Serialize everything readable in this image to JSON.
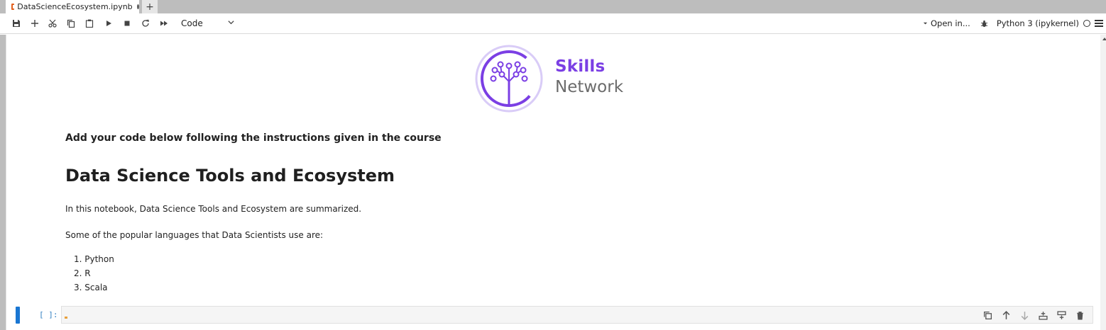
{
  "tab": {
    "title": "DataScienceEcosystem.ipynb",
    "new_tab": "+"
  },
  "toolbar": {
    "cell_type": "Code",
    "open_in": "Open in...",
    "kernel": "Python 3 (ipykernel)"
  },
  "logo": {
    "line1": "Skills",
    "line2": "Network",
    "brand_purple": "#7b3fe4"
  },
  "notebook": {
    "instruction": "Add your code below following the instructions given in the course",
    "heading": "Data Science Tools and Ecosystem",
    "intro": "In this notebook, Data Science Tools and Ecosystem are summarized.",
    "languages_intro": "Some of the popular languages that Data Scientists use are:",
    "languages": [
      "1. Python",
      "2. R",
      "3. Scala"
    ]
  },
  "cell": {
    "prompt": "[ ]:"
  },
  "icons": {
    "toolbar": [
      "save-icon",
      "add-cell-icon",
      "cut-icon",
      "copy-icon",
      "paste-icon",
      "run-icon",
      "stop-icon",
      "restart-icon",
      "run-all-icon"
    ],
    "cell_tools": [
      "duplicate-icon",
      "move-up-icon",
      "move-down-icon",
      "insert-above-icon",
      "insert-below-icon",
      "delete-icon"
    ]
  }
}
